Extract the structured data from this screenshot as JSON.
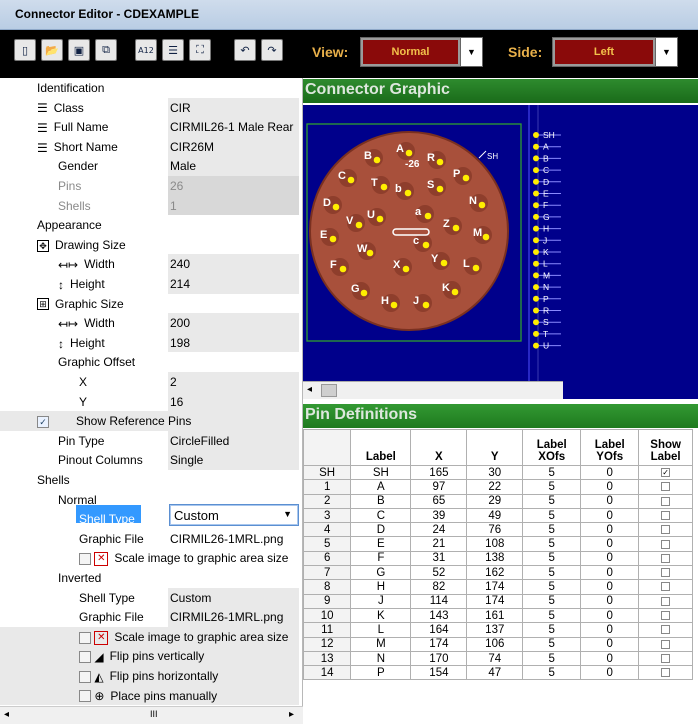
{
  "window": {
    "title": "Connector Editor - CDEXAMPLE"
  },
  "toolbar": {
    "view_label": "View:",
    "view_value": "Normal",
    "side_label": "Side:",
    "side_value": "Left",
    "buttons": [
      "new-icon",
      "open-icon",
      "save-icon",
      "copy-icon",
      "a12-icon",
      "list-icon",
      "fit-icon",
      "undo-icon",
      "redo-icon"
    ]
  },
  "properties": {
    "identification": "Identification",
    "class_k": "Class",
    "class_v": "CIR",
    "fullname_k": "Full Name",
    "fullname_v": "CIRMIL26-1 Male Rear",
    "shortname_k": "Short Name",
    "shortname_v": "CIR26M",
    "gender_k": "Gender",
    "gender_v": "Male",
    "pins_k": "Pins",
    "pins_v": "26",
    "shells_k": "Shells",
    "shells_v": "1",
    "appearance": "Appearance",
    "drawing_size": "Drawing Size",
    "dw_k": "Width",
    "dw_v": "240",
    "dh_k": "Height",
    "dh_v": "214",
    "graphic_size": "Graphic Size",
    "gw_k": "Width",
    "gw_v": "200",
    "gh_k": "Height",
    "gh_v": "198",
    "graphic_offset": "Graphic Offset",
    "ox_k": "X",
    "ox_v": "2",
    "oy_k": "Y",
    "oy_v": "16",
    "show_ref_pins": "Show Reference Pins",
    "pintype_k": "Pin Type",
    "pintype_v": "CircleFilled",
    "pinout_k": "Pinout Columns",
    "pinout_v": "Single",
    "shells": "Shells",
    "normal": "Normal",
    "shelltype_k": "Shell Type",
    "shelltype_v": "Custom",
    "graphicfile_k": "Graphic File",
    "graphicfile_v": "CIRMIL26-1MRL.png",
    "scale_label": "Scale image to graphic area size",
    "inverted": "Inverted",
    "inv_shelltype_k": "Shell Type",
    "inv_shelltype_v": "Custom",
    "inv_graphicfile_k": "Graphic File",
    "inv_graphicfile_v": "CIRMIL26-1MRL.png",
    "inv_scale_label": "Scale image to graphic area size",
    "flip_v": "Flip pins vertically",
    "flip_h": "Flip pins horizontally",
    "place_manual": "Place pins manually",
    "scroll_thumb": "III"
  },
  "graphic": {
    "title": "Connector Graphic",
    "sh_label": "SH",
    "center_label": "-26",
    "pin_letters": [
      "A",
      "B",
      "C",
      "D",
      "E",
      "F",
      "G",
      "H",
      "J",
      "K",
      "L",
      "M",
      "N",
      "P",
      "R",
      "S",
      "T",
      "U",
      "V",
      "W",
      "X",
      "Y",
      "Z",
      "a",
      "b",
      "c"
    ],
    "pin_list": [
      "SH",
      "A",
      "B",
      "C",
      "D",
      "E",
      "F",
      "G",
      "H",
      "J",
      "K",
      "L",
      "M",
      "N",
      "P",
      "R",
      "S",
      "T",
      "U"
    ]
  },
  "pins": {
    "title": "Pin Definitions",
    "headers": [
      "Label",
      "X",
      "Y",
      "Label XOfs",
      "Label YOfs",
      "Show Label"
    ],
    "rows": [
      {
        "rh": "SH",
        "label": "SH",
        "x": "165",
        "y": "30",
        "xo": "5",
        "yo": "0",
        "show": true
      },
      {
        "rh": "1",
        "label": "A",
        "x": "97",
        "y": "22",
        "xo": "5",
        "yo": "0",
        "show": false
      },
      {
        "rh": "2",
        "label": "B",
        "x": "65",
        "y": "29",
        "xo": "5",
        "yo": "0",
        "show": false
      },
      {
        "rh": "3",
        "label": "C",
        "x": "39",
        "y": "49",
        "xo": "5",
        "yo": "0",
        "show": false
      },
      {
        "rh": "4",
        "label": "D",
        "x": "24",
        "y": "76",
        "xo": "5",
        "yo": "0",
        "show": false
      },
      {
        "rh": "5",
        "label": "E",
        "x": "21",
        "y": "108",
        "xo": "5",
        "yo": "0",
        "show": false
      },
      {
        "rh": "6",
        "label": "F",
        "x": "31",
        "y": "138",
        "xo": "5",
        "yo": "0",
        "show": false
      },
      {
        "rh": "7",
        "label": "G",
        "x": "52",
        "y": "162",
        "xo": "5",
        "yo": "0",
        "show": false
      },
      {
        "rh": "8",
        "label": "H",
        "x": "82",
        "y": "174",
        "xo": "5",
        "yo": "0",
        "show": false
      },
      {
        "rh": "9",
        "label": "J",
        "x": "114",
        "y": "174",
        "xo": "5",
        "yo": "0",
        "show": false
      },
      {
        "rh": "10",
        "label": "K",
        "x": "143",
        "y": "161",
        "xo": "5",
        "yo": "0",
        "show": false
      },
      {
        "rh": "11",
        "label": "L",
        "x": "164",
        "y": "137",
        "xo": "5",
        "yo": "0",
        "show": false
      },
      {
        "rh": "12",
        "label": "M",
        "x": "174",
        "y": "106",
        "xo": "5",
        "yo": "0",
        "show": false
      },
      {
        "rh": "13",
        "label": "N",
        "x": "170",
        "y": "74",
        "xo": "5",
        "yo": "0",
        "show": false
      },
      {
        "rh": "14",
        "label": "P",
        "x": "154",
        "y": "47",
        "xo": "5",
        "yo": "0",
        "show": false
      }
    ]
  }
}
